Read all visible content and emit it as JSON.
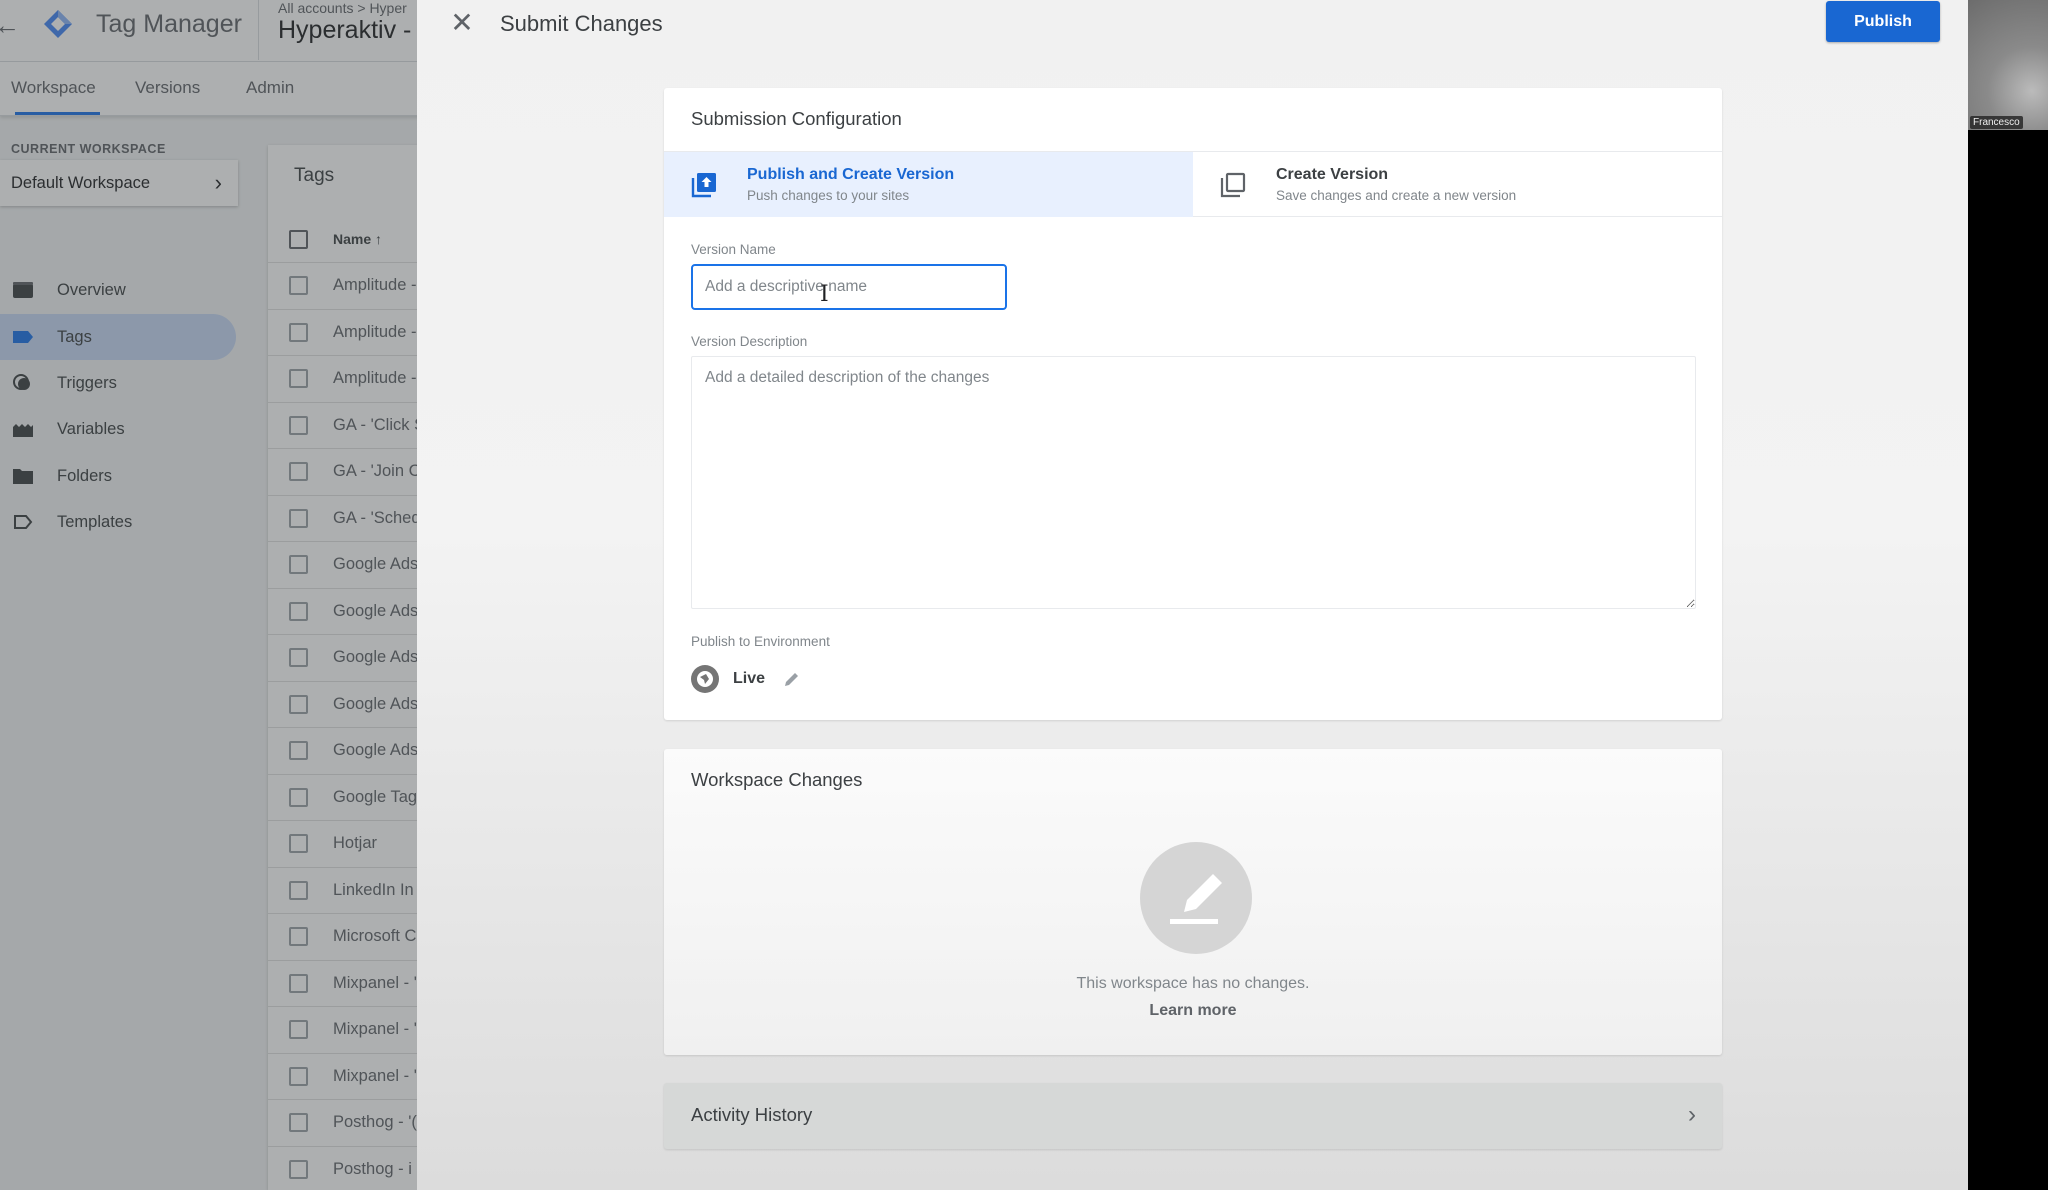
{
  "app": {
    "product_name": "Tag Manager",
    "breadcrumb": "All accounts > Hyper",
    "container_name": "Hyperaktiv -",
    "nav_tabs": [
      {
        "label": "Workspace",
        "active": true
      },
      {
        "label": "Versions",
        "active": false
      },
      {
        "label": "Admin",
        "active": false
      }
    ]
  },
  "sidebar": {
    "current_workspace_label": "CURRENT WORKSPACE",
    "workspace_name": "Default Workspace",
    "items": [
      {
        "label": "Overview",
        "icon": "overview-icon",
        "active": false
      },
      {
        "label": "Tags",
        "icon": "tag-icon",
        "active": true
      },
      {
        "label": "Triggers",
        "icon": "trigger-icon",
        "active": false
      },
      {
        "label": "Variables",
        "icon": "variables-icon",
        "active": false
      },
      {
        "label": "Folders",
        "icon": "folder-icon",
        "active": false
      },
      {
        "label": "Templates",
        "icon": "template-icon",
        "active": false
      }
    ]
  },
  "tags_list": {
    "title": "Tags",
    "column_name": "Name",
    "sort_icon": "arrow-up-icon",
    "rows": [
      "Amplitude -",
      "Amplitude -",
      "Amplitude -",
      "GA - 'Click S",
      "GA - 'Join C",
      "GA - 'Sched",
      "Google Ads",
      "Google Ads",
      "Google Ads",
      "Google Ads",
      "Google Ads",
      "Google Tag",
      "Hotjar",
      "LinkedIn In",
      "Microsoft C",
      "Mixpanel - '",
      "Mixpanel - '",
      "Mixpanel - '",
      "Posthog - '(",
      "Posthog - i"
    ]
  },
  "submit_panel": {
    "title": "Submit Changes",
    "publish_label": "Publish",
    "configuration": {
      "title": "Submission Configuration",
      "options": [
        {
          "title": "Publish and Create Version",
          "subtitle": "Push changes to your sites",
          "selected": true
        },
        {
          "title": "Create Version",
          "subtitle": "Save changes and create a new version",
          "selected": false
        }
      ],
      "version_name_label": "Version Name",
      "version_name_placeholder": "Add a descriptive name",
      "version_name_value": "",
      "version_description_label": "Version Description",
      "version_description_placeholder": "Add a detailed description of the changes",
      "version_description_value": "",
      "environment_label": "Publish to Environment",
      "environment_name": "Live"
    },
    "workspace_changes": {
      "title": "Workspace Changes",
      "empty_message": "This workspace has no changes.",
      "learn_more": "Learn more"
    },
    "activity_history": {
      "title": "Activity History"
    }
  },
  "webcam": {
    "participant_name": "Francesco"
  },
  "colors": {
    "accent": "#1a73e8",
    "publish_button": "#1967d2",
    "selected_option_bg": "#e8f0fe"
  }
}
